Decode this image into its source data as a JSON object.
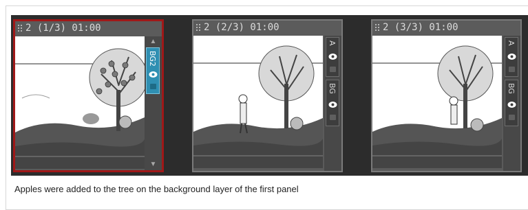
{
  "panels": [
    {
      "title": "2 (1/3) 01:00",
      "layers": [
        {
          "name": "BG2"
        }
      ]
    },
    {
      "title": "2 (2/3) 01:00",
      "layers": [
        {
          "name": "A"
        },
        {
          "name": "BG"
        }
      ]
    },
    {
      "title": "2 (3/3) 01:00",
      "layers": [
        {
          "name": "A"
        },
        {
          "name": "BG"
        }
      ]
    }
  ],
  "caption": "Apples were added to the tree on the background layer of the first panel",
  "colors": {
    "selected_border": "#a01818",
    "active_layer": "#2f8fb2",
    "strip_background": "#2c2c2c"
  },
  "icons": {
    "visibility": "eye-icon",
    "lock": "lock-icon",
    "grip": "drag-grip-icon",
    "scroll_up": "scroll-up-arrow-icon",
    "scroll_down": "scroll-down-arrow-icon"
  }
}
